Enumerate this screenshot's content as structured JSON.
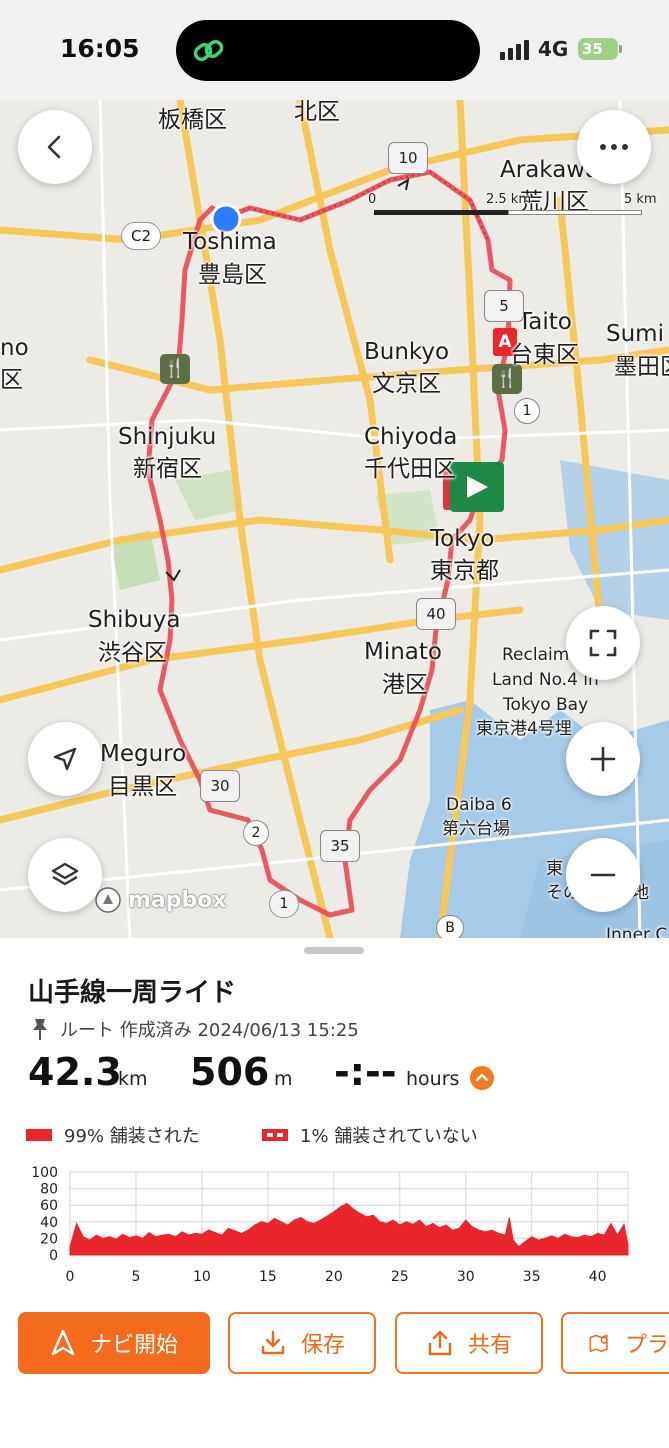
{
  "status_bar": {
    "time": "16:05",
    "network": "4G",
    "battery": "35"
  },
  "map": {
    "labels": {
      "itabashi": "板橋区",
      "kita": "北区",
      "arakawa": "Arakawa",
      "arakawa_jp": "荒川区",
      "toshima": "Toshima",
      "toshima_jp": "豊島区",
      "taito": "Taito",
      "taito_jp": "台東区",
      "sumida": "Sumi",
      "sumida_jp": "墨田区",
      "bunkyo": "Bunkyo",
      "bunkyo_jp": "文京区",
      "shinjuku": "Shinjuku",
      "shinjuku_jp": "新宿区",
      "chiyoda": "Chiyoda",
      "chiyoda_jp": "千代田区",
      "tokyo": "Tokyo",
      "tokyo_jp": "東京都",
      "shibuya": "Shibuya",
      "shibuya_jp": "渋谷区",
      "minato": "Minato",
      "minato_jp": "港区",
      "meguro": "Meguro",
      "meguro_jp": "目黒区",
      "reclaim1": "Reclaim",
      "reclaim2": "Land No.4 in",
      "tokyobay": "Tokyo Bay",
      "tokyoport": "東京港4号埋",
      "daiba": "Daiba 6",
      "daiba_jp": "第六台場",
      "inner": "Inner C",
      "edge_left1": "no",
      "edge_left2": "区",
      "shiro": "東",
      "shiro2": "その",
      "chi": "地"
    },
    "km_markers": [
      "10",
      "5",
      "40",
      "30",
      "35"
    ],
    "road_shields": [
      "C2",
      "1",
      "2",
      "1",
      "B"
    ],
    "scale": {
      "zero": "0",
      "mid": "2.5 km",
      "end": "5 km"
    },
    "start_marker": "A",
    "attribution": "mapbox"
  },
  "route": {
    "title": "山手線一周ライド",
    "meta": "ルート 作成済み 2024/06/13 15:25",
    "distance_value": "42.3",
    "distance_unit": "km",
    "elevation_value": "506",
    "elevation_unit": "m",
    "time_value": "-:--",
    "time_unit": "hours",
    "legend_paved": "99% 舗装された",
    "legend_unpaved": "1% 舗装されていない"
  },
  "chart_data": {
    "type": "area",
    "title": "",
    "xlabel": "",
    "ylabel": "",
    "x_ticks": [
      0,
      5,
      10,
      15,
      20,
      25,
      30,
      35,
      40
    ],
    "y_ticks": [
      0,
      20,
      40,
      60,
      80,
      100
    ],
    "xlim": [
      0,
      42.3
    ],
    "ylim": [
      0,
      100
    ],
    "grid": true,
    "series": [
      {
        "color": "#e8262c",
        "x": [
          0,
          0.5,
          1,
          1.5,
          2,
          2.5,
          3,
          3.5,
          4,
          4.5,
          5,
          5.5,
          6,
          6.5,
          7,
          7.5,
          8,
          8.5,
          9,
          9.5,
          10,
          10.5,
          11,
          11.5,
          12,
          12.5,
          13,
          13.5,
          14,
          14.5,
          15,
          15.5,
          16,
          16.5,
          17,
          17.5,
          18,
          18.5,
          19,
          19.5,
          20,
          20.5,
          21,
          21.5,
          22,
          22.5,
          23,
          23.5,
          24,
          24.5,
          25,
          25.5,
          26,
          26.5,
          27,
          27.5,
          28,
          28.5,
          29,
          29.5,
          30,
          30.5,
          31,
          31.5,
          32,
          32.5,
          33,
          33.3,
          33.6,
          34,
          34.5,
          35,
          35.5,
          36,
          36.5,
          37,
          37.5,
          38,
          38.5,
          39,
          39.5,
          40,
          40.5,
          41,
          41.5,
          42,
          42.3
        ],
        "values": [
          10,
          38,
          22,
          18,
          24,
          20,
          22,
          19,
          25,
          21,
          23,
          20,
          27,
          22,
          24,
          25,
          22,
          28,
          24,
          26,
          25,
          30,
          27,
          24,
          32,
          29,
          26,
          30,
          36,
          40,
          38,
          44,
          40,
          36,
          42,
          45,
          40,
          38,
          42,
          47,
          52,
          58,
          62,
          55,
          50,
          46,
          48,
          40,
          38,
          42,
          36,
          40,
          37,
          42,
          34,
          38,
          33,
          36,
          30,
          32,
          42,
          34,
          30,
          28,
          30,
          26,
          24,
          45,
          18,
          10,
          16,
          22,
          18,
          20,
          23,
          20,
          25,
          22,
          21,
          24,
          22,
          26,
          24,
          38,
          24,
          37,
          12
        ]
      }
    ]
  },
  "actions": {
    "navi": "ナビ開始",
    "save": "保存",
    "share": "共有",
    "more": "プラ"
  }
}
